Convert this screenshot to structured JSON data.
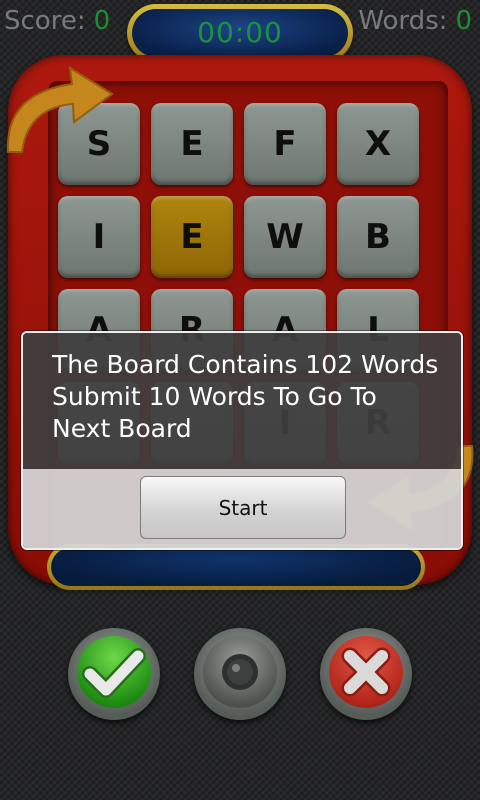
{
  "hud": {
    "score_label": "Score:",
    "score_value": "0",
    "words_label": "Words:",
    "words_value": "0",
    "timer": "00:00"
  },
  "board": {
    "tiles": [
      [
        "S",
        "E",
        "F",
        "X"
      ],
      [
        "I",
        "E",
        "W",
        "B"
      ],
      [
        "A",
        "R",
        "A",
        "L"
      ],
      [
        "",
        "",
        "I",
        "R"
      ]
    ],
    "selected_tile": "E (row 2, column 2)"
  },
  "dialog": {
    "message_lines": [
      "The Board Contains 102 Words",
      "Submit 10 Words To Go To",
      "Next Board"
    ],
    "start_label": "Start"
  },
  "buttons": {
    "submit_icon": "checkmark-icon",
    "sound_icon": "speaker-icon",
    "clear_icon": "x-icon"
  },
  "colors": {
    "counter_green": "#21a23a",
    "board_red": "#c61d10",
    "selected_tile": "#c79812",
    "timer_blue": "#0b2452"
  }
}
